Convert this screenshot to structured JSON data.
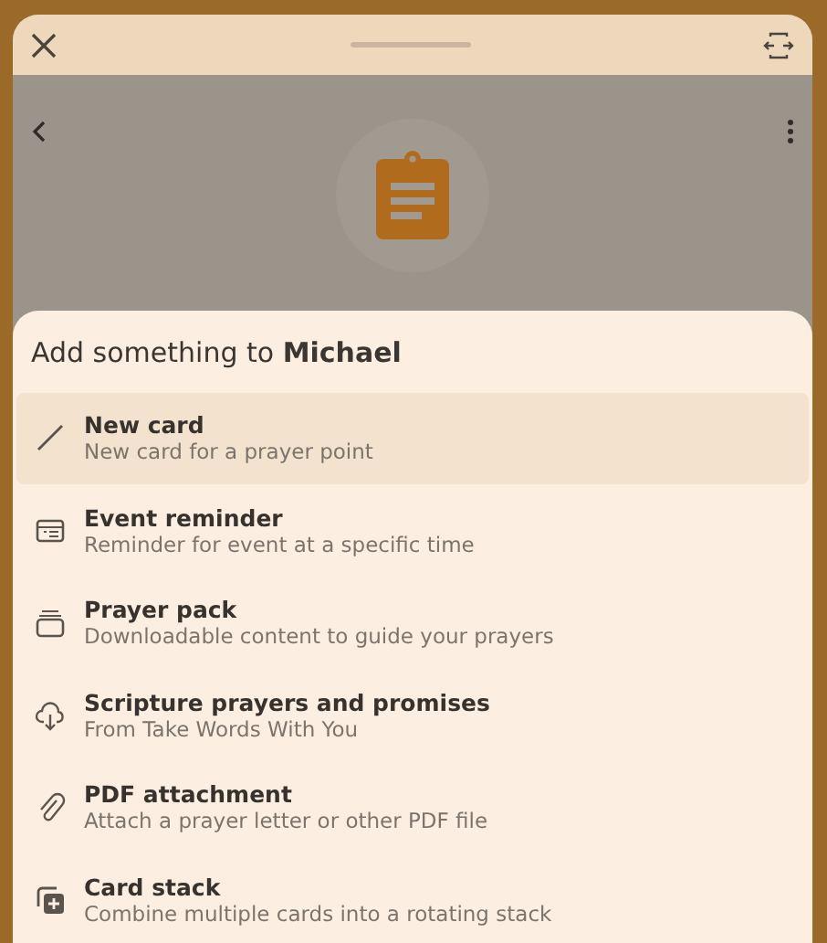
{
  "sheet": {
    "title": "Add something to **Michael**",
    "items": [
      {
        "title": "New card",
        "subtitle": "New card for a prayer point",
        "selected": true
      },
      {
        "title": "Event reminder",
        "subtitle": "Reminder for event at a specific time",
        "selected": false
      },
      {
        "title": "Prayer pack",
        "subtitle": "Downloadable content to guide your prayers",
        "selected": false
      },
      {
        "title": "Scripture prayers and promises",
        "subtitle": "From Take Words With You",
        "selected": false
      },
      {
        "title": "PDF attachment",
        "subtitle": "Attach a prayer letter or other PDF file",
        "selected": false
      },
      {
        "title": "Card stack",
        "subtitle": "Combine multiple cards into a rotating stack",
        "selected": false
      }
    ]
  }
}
